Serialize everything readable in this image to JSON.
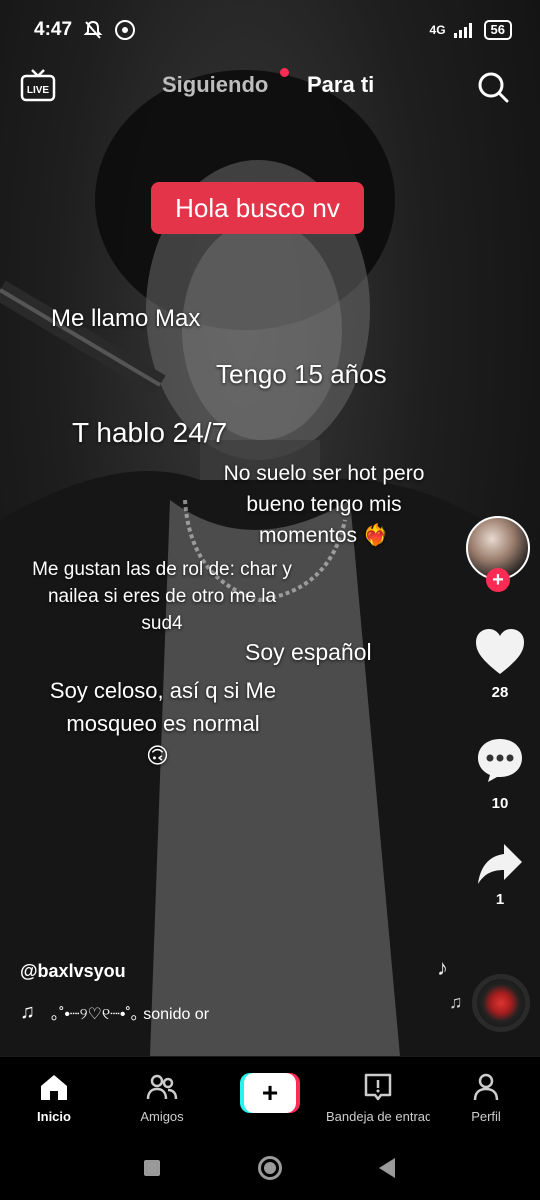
{
  "status_bar": {
    "time": "4:47",
    "network": "4G",
    "battery": "56"
  },
  "top_nav": {
    "live_label": "LIVE",
    "following_label": "Siguiendo",
    "for_you_label": "Para ti"
  },
  "overlay": {
    "headline": "Hola busco nv",
    "line1": "Me llamo Max",
    "line2": "Tengo 15 años",
    "line3": "T hablo 24/7",
    "line4": "No suelo ser hot pero bueno tengo mis momentos ❤️‍🔥",
    "line5": "Me gustan las de rol de: char y nailea si eres de otro me la sud4",
    "line6": "Soy español",
    "line7": "Soy celoso, así q si Me mosqueo es normal",
    "line8": "🙃"
  },
  "actions": {
    "likes": "28",
    "comments": "10",
    "shares": "1"
  },
  "caption": {
    "username": "@baxlvsyou",
    "sound": "｡˚•┈୨♡୧┈•˚｡   sonido or"
  },
  "bottom_nav": {
    "home": "Inicio",
    "friends": "Amigos",
    "inbox": "Bandeja de entrada",
    "profile": "Perfil"
  }
}
